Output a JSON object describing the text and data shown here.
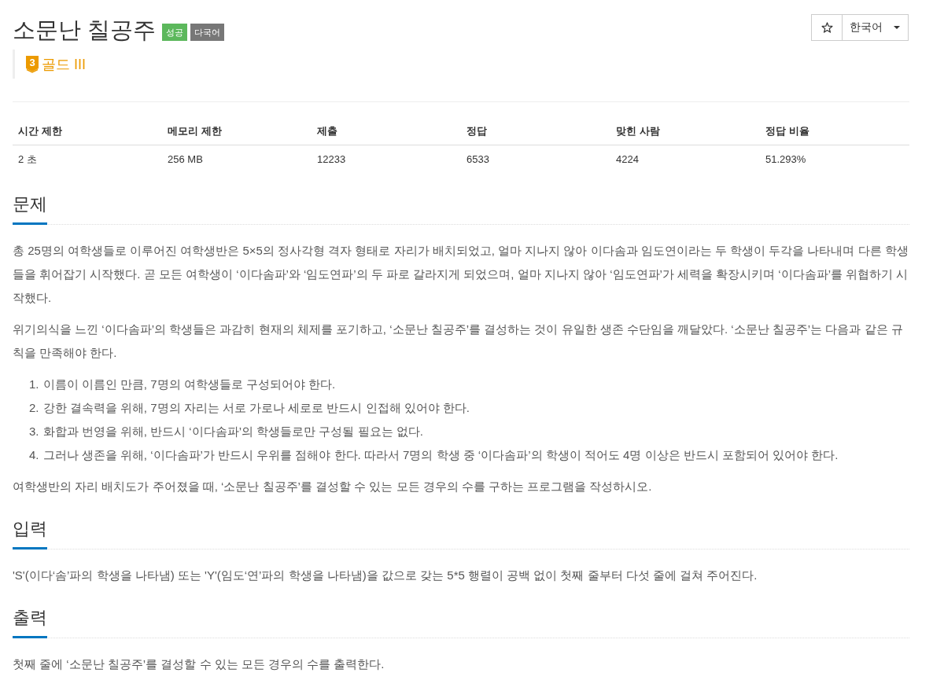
{
  "header": {
    "title": "소문난 칠공주",
    "badges": [
      {
        "label": "성공",
        "kind": "success"
      },
      {
        "label": "다국어",
        "kind": "multilang"
      }
    ],
    "favorite_button": {
      "starred": false
    },
    "language_dropdown": {
      "value": "한국어"
    }
  },
  "tier": {
    "number": "3",
    "label": "골드 III"
  },
  "table": {
    "columns": [
      "시간 제한",
      "메모리 제한",
      "제출",
      "정답",
      "맞힌 사람",
      "정답 비율"
    ],
    "rows": [
      [
        "2 초",
        "256 MB",
        "12233",
        "6533",
        "4224",
        "51.293%"
      ]
    ]
  },
  "sections": [
    {
      "title": "문제",
      "blocks": [
        {
          "kind": "paragraph",
          "text": "총 25명의 여학생들로 이루어진 여학생반은 5×5의 정사각형 격자 형태로 자리가 배치되었고, 얼마 지나지 않아 이다솜과 임도연이라는 두 학생이 두각을 나타내며 다른 학생들을 휘어잡기 시작했다. 곧 모든 여학생이 ‘이다솜파’와 ‘임도연파’의 두 파로 갈라지게 되었으며, 얼마 지나지 않아 ‘임도연파’가 세력을 확장시키며 ‘이다솜파’를 위협하기 시작했다."
        },
        {
          "kind": "paragraph",
          "text": "위기의식을 느낀 ‘이다솜파’의 학생들은 과감히 현재의 체제를 포기하고, ‘소문난 칠공주’를 결성하는 것이 유일한 생존 수단임을 깨달았다. ‘소문난 칠공주’는 다음과 같은 규칙을 만족해야 한다."
        },
        {
          "kind": "list",
          "items": [
            {
              "number": "1.",
              "text": "이름이 이름인 만큼, 7명의 여학생들로 구성되어야 한다."
            },
            {
              "number": "2.",
              "text": "강한 결속력을 위해, 7명의 자리는 서로 가로나 세로로 반드시 인접해 있어야 한다."
            },
            {
              "number": "3.",
              "text": "화합과 번영을 위해, 반드시 ‘이다솜파’의 학생들로만 구성될 필요는 없다."
            },
            {
              "number": "4.",
              "text": "그러나 생존을 위해, ‘이다솜파’가 반드시 우위를 점해야 한다. 따라서 7명의 학생 중 ‘이다솜파’의 학생이 적어도 4명 이상은 반드시 포함되어 있어야 한다."
            }
          ]
        },
        {
          "kind": "paragraph",
          "text": "여학생반의 자리 배치도가 주어졌을 때, ‘소문난 칠공주’를 결성할 수 있는 모든 경우의 수를 구하는 프로그램을 작성하시오."
        }
      ]
    },
    {
      "title": "입력",
      "blocks": [
        {
          "kind": "paragraph",
          "text": "'S'(이다‘솜’파의 학생을 나타냄) 또는 'Y'(임도‘연’파의 학생을 나타냄)을 값으로 갖는 5*5 행렬이 공백 없이 첫째 줄부터 다섯 줄에 걸쳐 주어진다."
        }
      ]
    },
    {
      "title": "출력",
      "blocks": [
        {
          "kind": "paragraph",
          "text": "첫째 줄에 ‘소문난 칠공주’를 결성할 수 있는 모든 경우의 수를 출력한다."
        }
      ]
    }
  ]
}
